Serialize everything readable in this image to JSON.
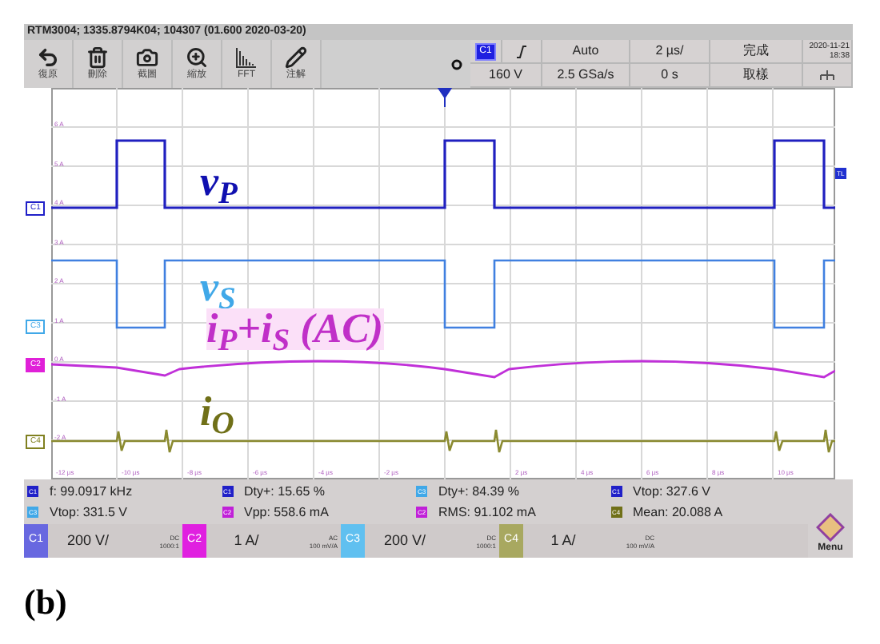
{
  "title_bar": "RTM3004; 1335.8794K04; 104307 (01.600 2020-03-20)",
  "toolbar": [
    {
      "kind": "undo",
      "label": "復原"
    },
    {
      "kind": "trash",
      "label": "刪除"
    },
    {
      "kind": "camera",
      "label": "截圖"
    },
    {
      "kind": "zoom",
      "label": "縮放"
    },
    {
      "kind": "fft",
      "label": "FFT"
    },
    {
      "kind": "pencil",
      "label": "注解"
    }
  ],
  "trigger_panel": {
    "source": "C1",
    "mode": "Auto",
    "timebase": "2 µs/",
    "status": "完成",
    "date": "2020-11-21",
    "time": "18:38",
    "level": "160 V",
    "sample_rate": "2.5 GSa/s",
    "position": "0 s",
    "acquire": "取樣"
  },
  "plot": {
    "y_labels": [
      "6 A",
      "5 A",
      "4 A",
      "3 A",
      "2 A",
      "1 A",
      "0 A",
      "-1 A",
      "-2 A"
    ],
    "x_labels": [
      "-12 µs",
      "-10 µs",
      "-8 µs",
      "-6 µs",
      "-4 µs",
      "-2 µs",
      "2 µs",
      "4 µs",
      "6 µs",
      "8 µs",
      "10 µs"
    ],
    "markers": [
      {
        "label": "C1",
        "color": "#2020c8",
        "filled": false
      },
      {
        "label": "C3",
        "color": "#40a8e8",
        "filled": false
      },
      {
        "label": "C2",
        "color": "#e020d8",
        "filled": true
      },
      {
        "label": "C4",
        "color": "#808020",
        "filled": false
      }
    ],
    "trigger_marker": "TL",
    "trace_labels": [
      {
        "text": "v$_{P}$",
        "color": "#1010b0"
      },
      {
        "text": "v$_{S}$",
        "color": "#40a8e8"
      },
      {
        "text": "i$_{P}$+i$_{S}$ (AC)",
        "color": "#c030c8"
      },
      {
        "text": "i$_{O}$",
        "color": "#707018"
      }
    ]
  },
  "measurements": [
    {
      "channel": "C1",
      "color": "#2020c8",
      "text": "f: 99.0917 kHz"
    },
    {
      "channel": "C1",
      "color": "#2020c8",
      "text": "Dty+: 15.65 %"
    },
    {
      "channel": "C3",
      "color": "#40a8e8",
      "text": "Dty+: 84.39 %"
    },
    {
      "channel": "C1",
      "color": "#2020c8",
      "text": "Vtop: 327.6 V"
    },
    {
      "channel": "C3",
      "color": "#40a8e8",
      "text": "Vtop: 331.5 V"
    },
    {
      "channel": "C2",
      "color": "#c020d8",
      "text": "Vpp: 558.6 mA"
    },
    {
      "channel": "C2",
      "color": "#c020d8",
      "text": "RMS: 91.102 mA"
    },
    {
      "channel": "C4",
      "color": "#707018",
      "text": "Mean: 20.088 A"
    }
  ],
  "channels": [
    {
      "label": "C1",
      "color": "#6868e0",
      "scale": "200 V/",
      "coupling": "DC",
      "probe": "1000:1"
    },
    {
      "label": "C2",
      "color": "#e020e0",
      "scale": "1 A/",
      "coupling": "AC",
      "probe": "100 mV/A"
    },
    {
      "label": "C3",
      "color": "#60c0f0",
      "scale": "200 V/",
      "coupling": "DC",
      "probe": "1000:1"
    },
    {
      "label": "C4",
      "color": "#a8a860",
      "scale": "1 A/",
      "coupling": "DC",
      "probe": "100 mV/A"
    }
  ],
  "menu": "Menu",
  "figure_label": "(b)"
}
